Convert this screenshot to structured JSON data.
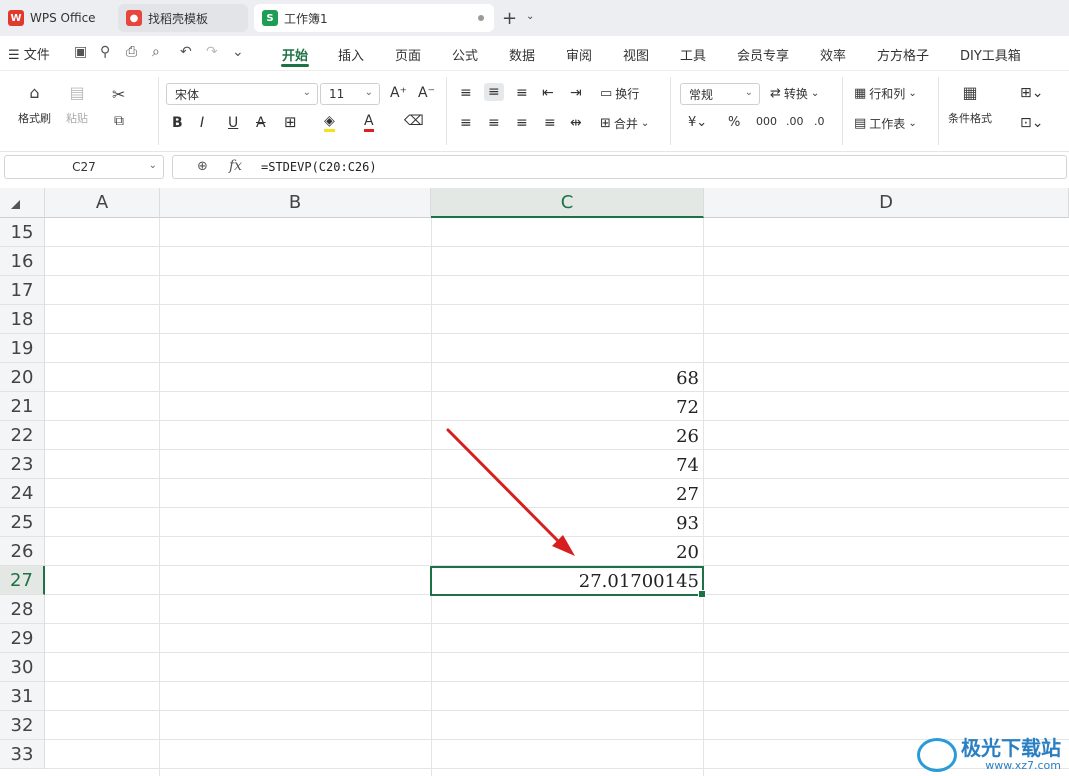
{
  "tabs": [
    {
      "label": "WPS Office",
      "icon": "wps-logo-icon"
    },
    {
      "label": "找稻壳模板",
      "icon": "docer-icon"
    },
    {
      "label": "工作簿1",
      "icon": "sheet-icon"
    }
  ],
  "menu": {
    "file": "文件",
    "items": [
      "开始",
      "插入",
      "页面",
      "公式",
      "数据",
      "审阅",
      "视图",
      "工具",
      "会员专享",
      "效率",
      "方方格子",
      "DIY工具箱"
    ],
    "active": "开始"
  },
  "ribbon": {
    "format_painter": "格式刷",
    "paste": "粘贴",
    "font_name": "宋体",
    "font_size": "11",
    "wrap": "换行",
    "merge": "合并",
    "number_format": "常规",
    "convert": "转换",
    "row_col": "行和列",
    "worksheet": "工作表",
    "cond_format": "条件格式"
  },
  "formula_bar": {
    "name_box": "C27",
    "fx": "fx",
    "formula": "=STDEVP(C20:C26)"
  },
  "sheet": {
    "columns": [
      "A",
      "B",
      "C",
      "D"
    ],
    "selected_column": "C",
    "rows": [
      "15",
      "16",
      "17",
      "18",
      "19",
      "20",
      "21",
      "22",
      "23",
      "24",
      "25",
      "26",
      "27",
      "28",
      "29",
      "30",
      "31",
      "32",
      "33"
    ],
    "selected_row": "27",
    "c_values": {
      "20": "68",
      "21": "72",
      "22": "26",
      "23": "74",
      "24": "27",
      "25": "93",
      "26": "20",
      "27": "27.01700145"
    }
  },
  "watermark": {
    "text": "极光下载站",
    "url": "www.xz7.com"
  },
  "colors": {
    "accent": "#1e7145",
    "arrow": "#d62020"
  }
}
